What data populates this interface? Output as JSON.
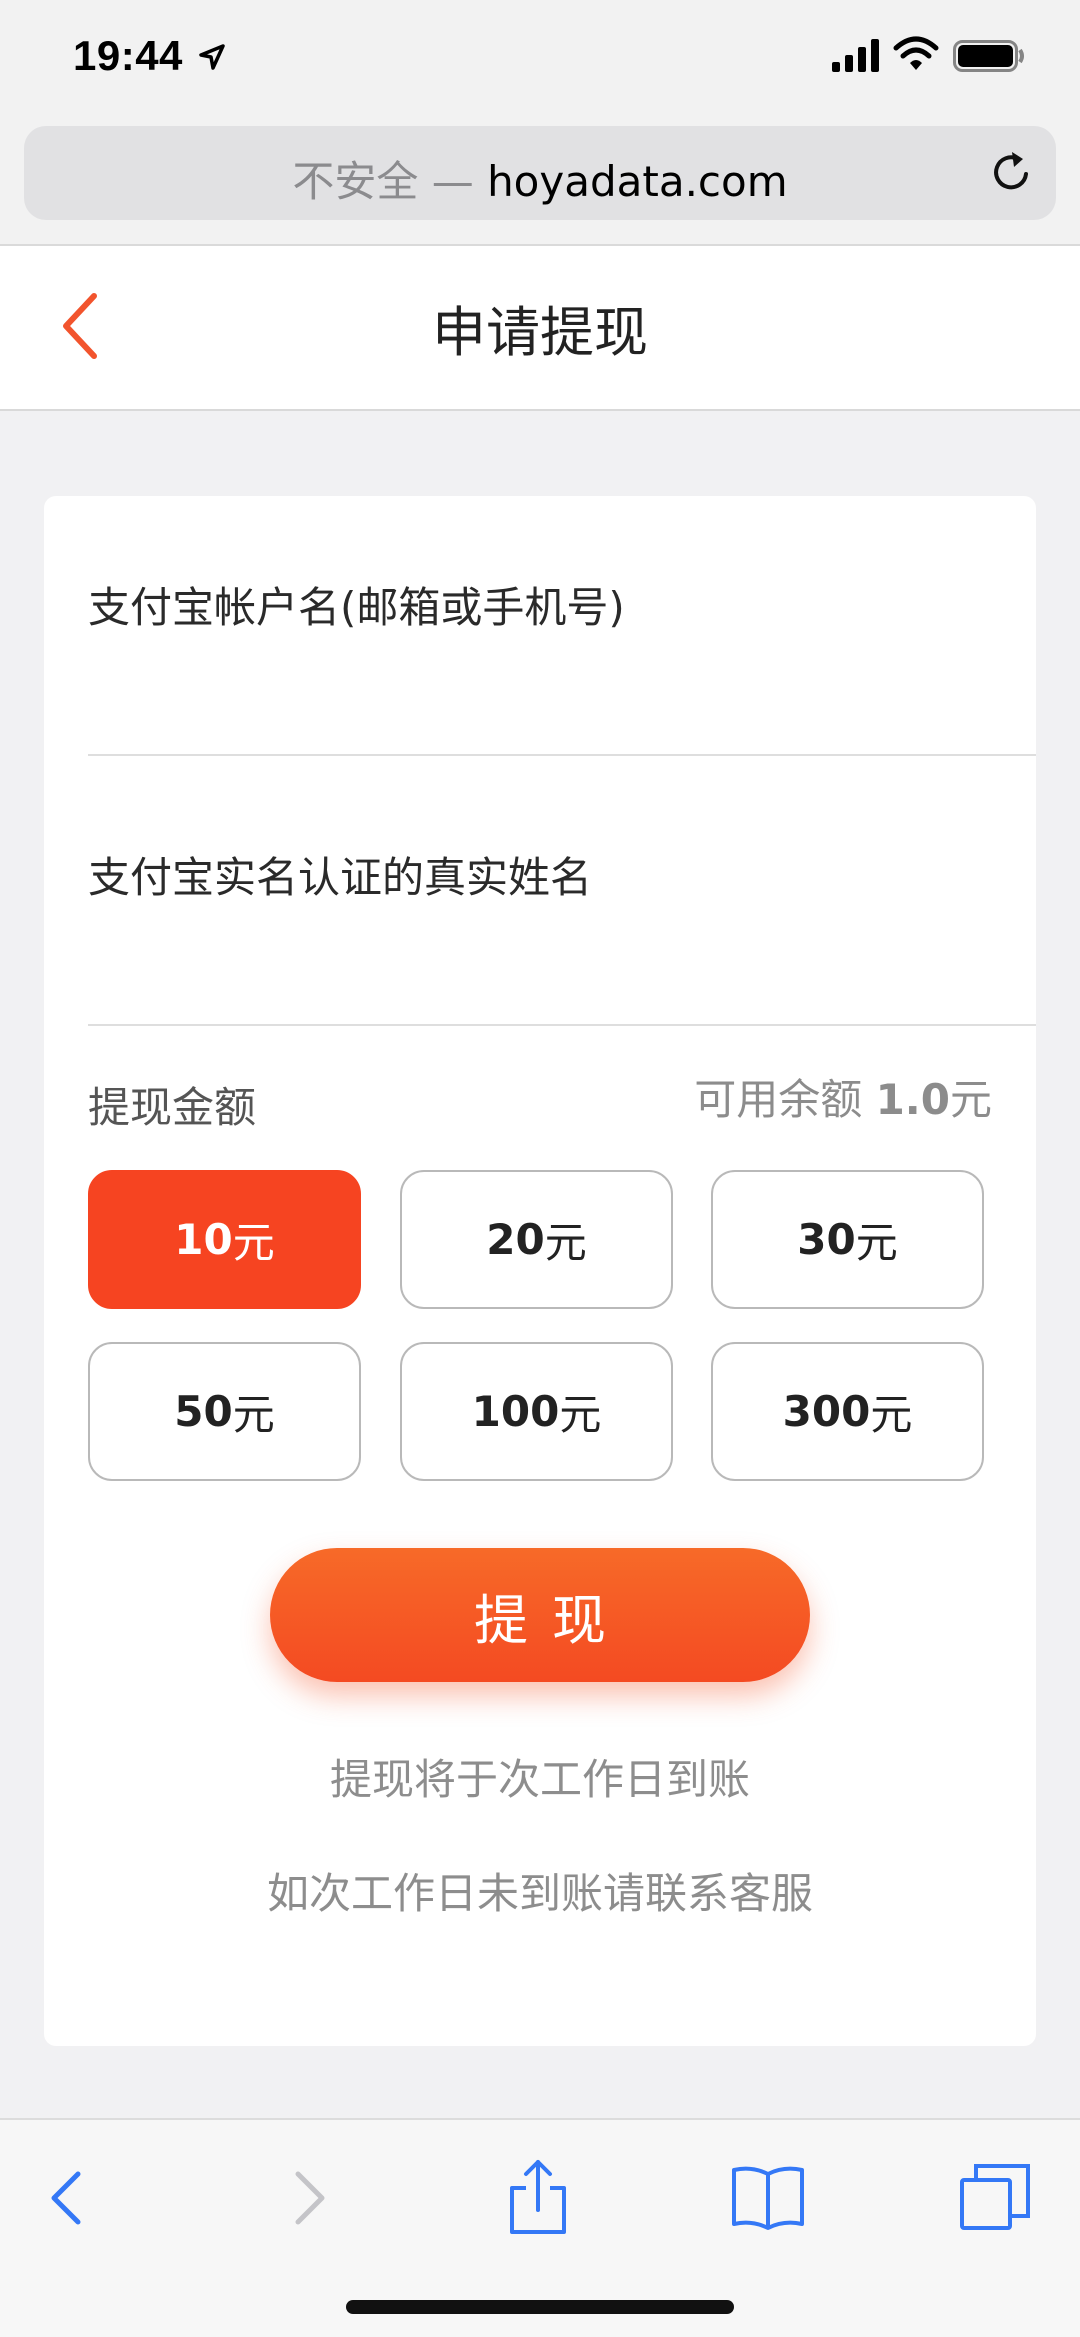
{
  "status_bar": {
    "time": "19:44"
  },
  "browser": {
    "url_prefix": "不安全 — ",
    "url_domain": "hoyadata.com"
  },
  "header": {
    "title": "申请提现"
  },
  "form": {
    "account_label": "支付宝帐户名(邮箱或手机号)",
    "account_value": "",
    "name_label": "支付宝实名认证的真实姓名",
    "name_value": "",
    "amount_label": "提现金额",
    "balance_prefix": "可用余额 ",
    "balance_value": "1.0",
    "balance_unit": "元",
    "amounts": [
      {
        "value": "10",
        "unit": "元",
        "selected": true
      },
      {
        "value": "20",
        "unit": "元",
        "selected": false
      },
      {
        "value": "30",
        "unit": "元",
        "selected": false
      },
      {
        "value": "50",
        "unit": "元",
        "selected": false
      },
      {
        "value": "100",
        "unit": "元",
        "selected": false
      },
      {
        "value": "300",
        "unit": "元",
        "selected": false
      }
    ],
    "submit_label": "提现",
    "note_1": "提现将于次工作日到账",
    "note_2": "如次工作日未到账请联系客服"
  },
  "colors": {
    "accent": "#f64421",
    "accent_gradient_top": "#f76a28",
    "ios_blue": "#3478f6"
  },
  "toolbar": {
    "icons": [
      "back-icon",
      "forward-icon",
      "share-icon",
      "bookmarks-icon",
      "tabs-icon"
    ]
  }
}
